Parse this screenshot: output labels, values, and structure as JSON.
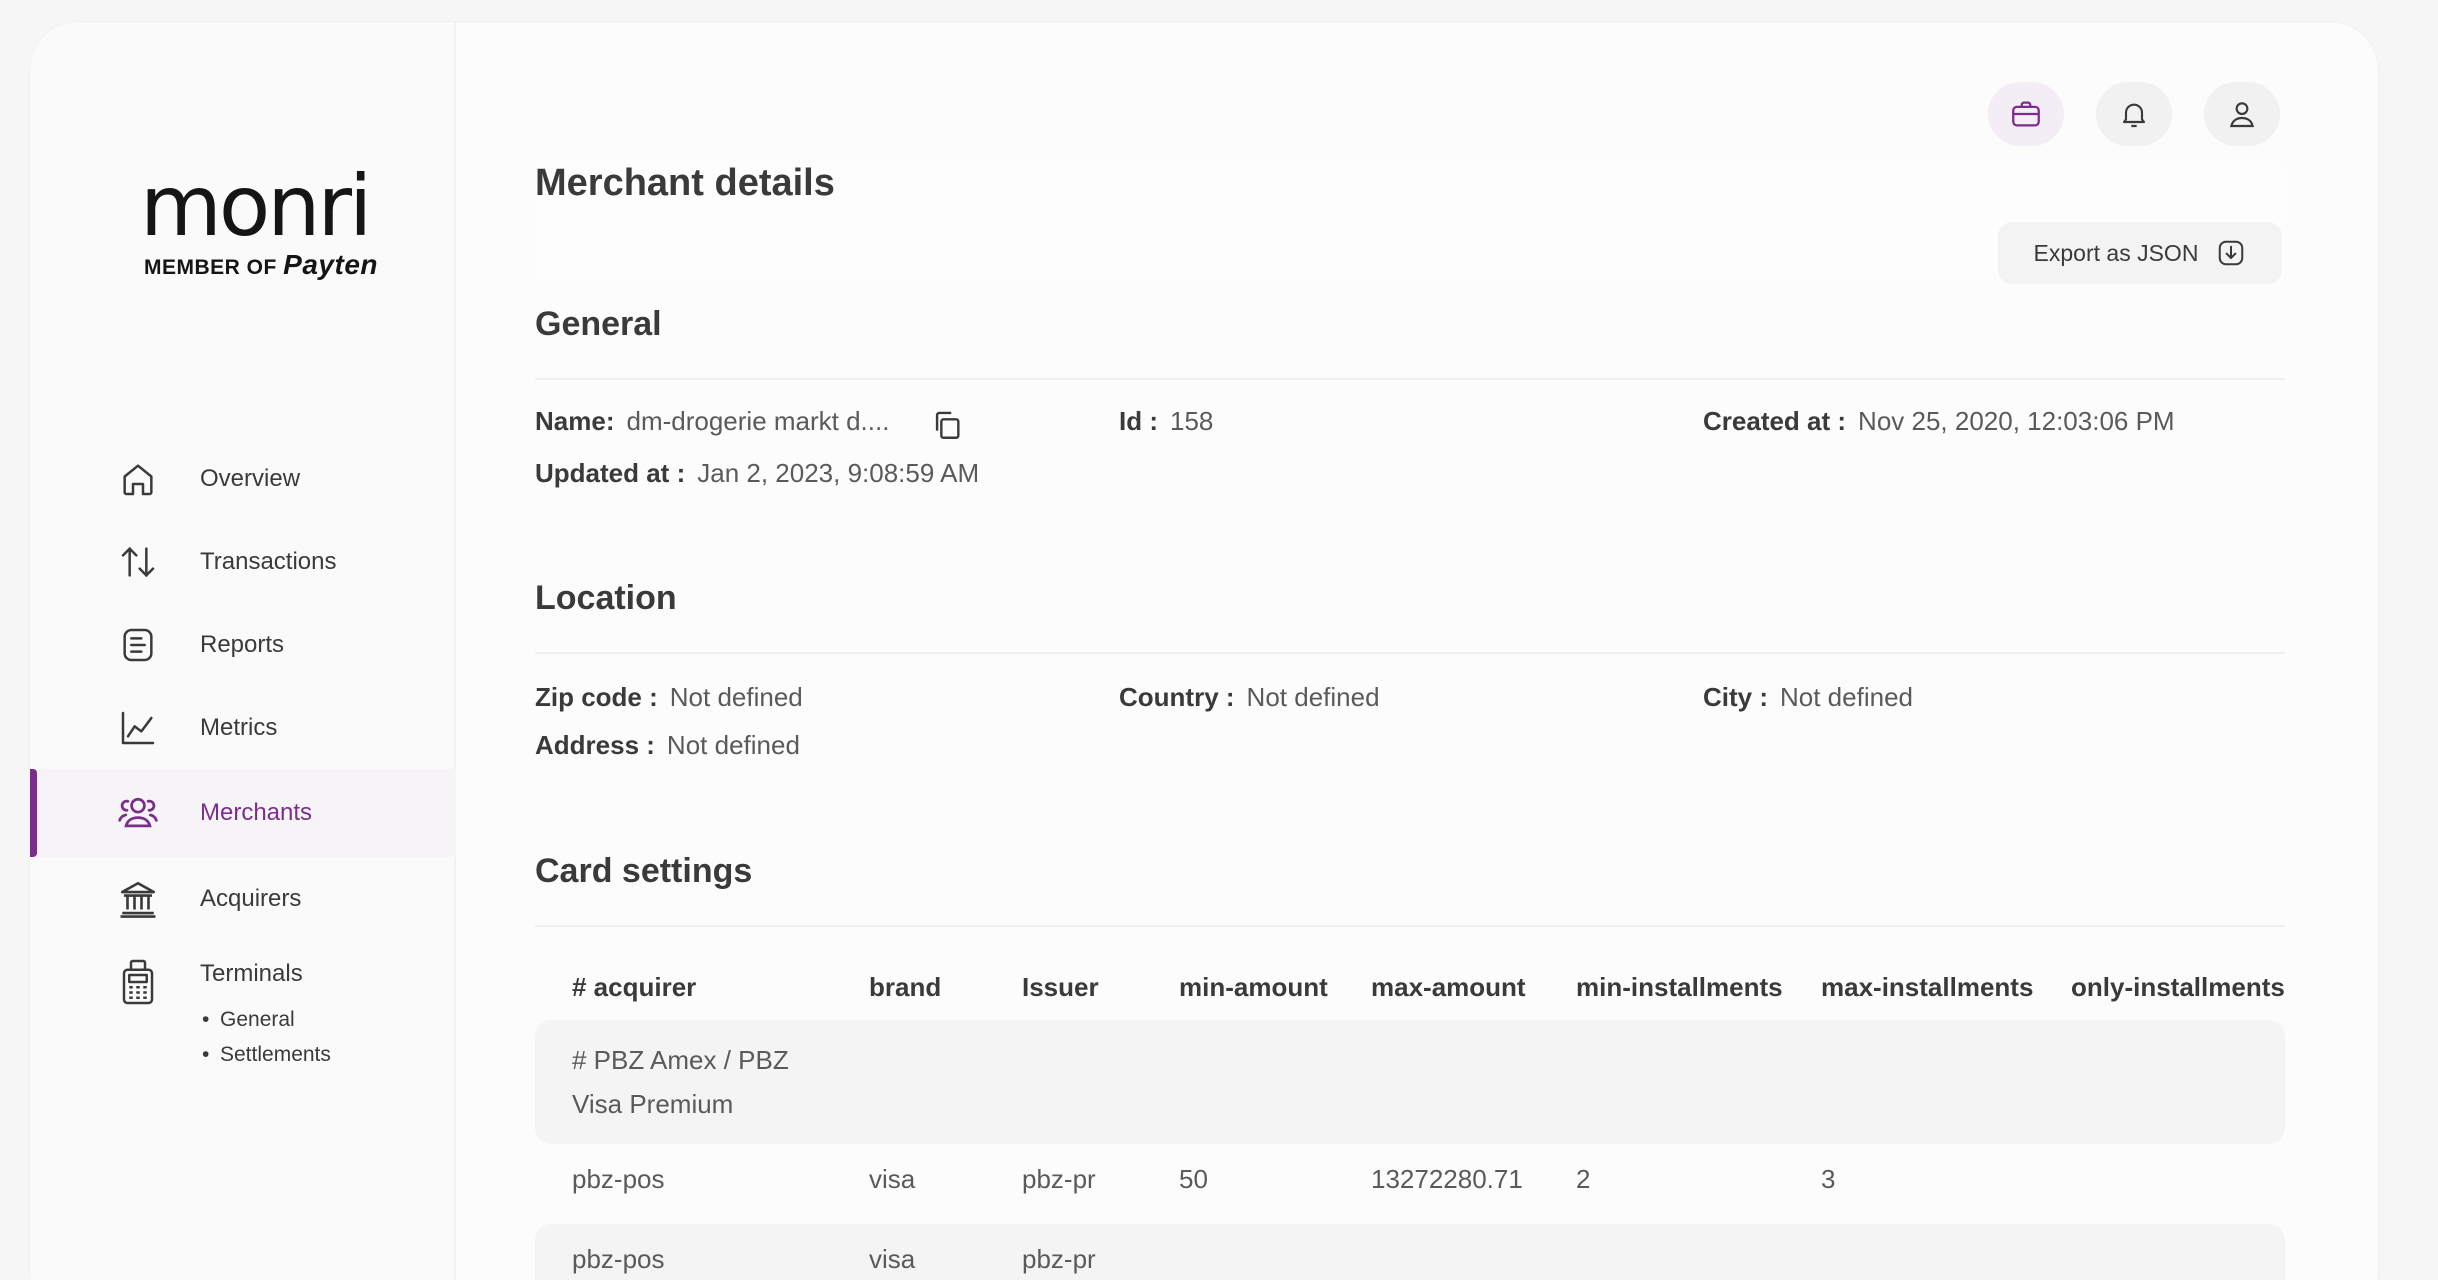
{
  "logo": {
    "word": "monri",
    "member_of": "MEMBER OF",
    "brand": "Payten"
  },
  "nav": {
    "items": [
      {
        "label": "Overview",
        "icon": "home-icon"
      },
      {
        "label": "Transactions",
        "icon": "arrows-up-down-icon"
      },
      {
        "label": "Reports",
        "icon": "report-icon"
      },
      {
        "label": "Metrics",
        "icon": "chart-line-icon"
      },
      {
        "label": "Merchants",
        "icon": "users-icon",
        "active": true
      },
      {
        "label": "Acquirers",
        "icon": "bank-icon"
      },
      {
        "label": "Terminals",
        "icon": "terminal-icon"
      }
    ],
    "terminals_sub": [
      "General",
      "Settlements"
    ]
  },
  "page": {
    "title": "Merchant details",
    "export_label": "Export as JSON"
  },
  "general": {
    "title": "General",
    "name_label": "Name:",
    "name_value": "dm-drogerie markt d....",
    "id_label": "Id :",
    "id_value": "158",
    "created_label": "Created at :",
    "created_value": "Nov 25, 2020, 12:03:06 PM",
    "updated_label": "Updated at :",
    "updated_value": "Jan 2, 2023, 9:08:59 AM"
  },
  "location": {
    "title": "Location",
    "zip_label": "Zip code :",
    "zip_value": "Not defined",
    "country_label": "Country :",
    "country_value": "Not defined",
    "city_label": "City :",
    "city_value": "Not defined",
    "address_label": "Address :",
    "address_value": "Not defined"
  },
  "card_settings": {
    "title": "Card settings",
    "columns": [
      "# acquirer",
      "brand",
      "Issuer",
      "min-amount",
      "max-amount",
      "min-installments",
      "max-installments",
      "only-installments"
    ],
    "group_line1": "# PBZ Amex / PBZ",
    "group_line2": "Visa Premium",
    "rows": [
      [
        "pbz-pos",
        "visa",
        "pbz-pr",
        "50",
        "13272280.71",
        "2",
        "3",
        ""
      ],
      [
        "pbz-pos",
        "visa",
        "pbz-pr",
        "",
        "",
        "",
        "",
        ""
      ]
    ]
  },
  "colors": {
    "accent": "#7c2d8c",
    "text": "#3a3a3c",
    "muted": "#5a5a5c"
  }
}
